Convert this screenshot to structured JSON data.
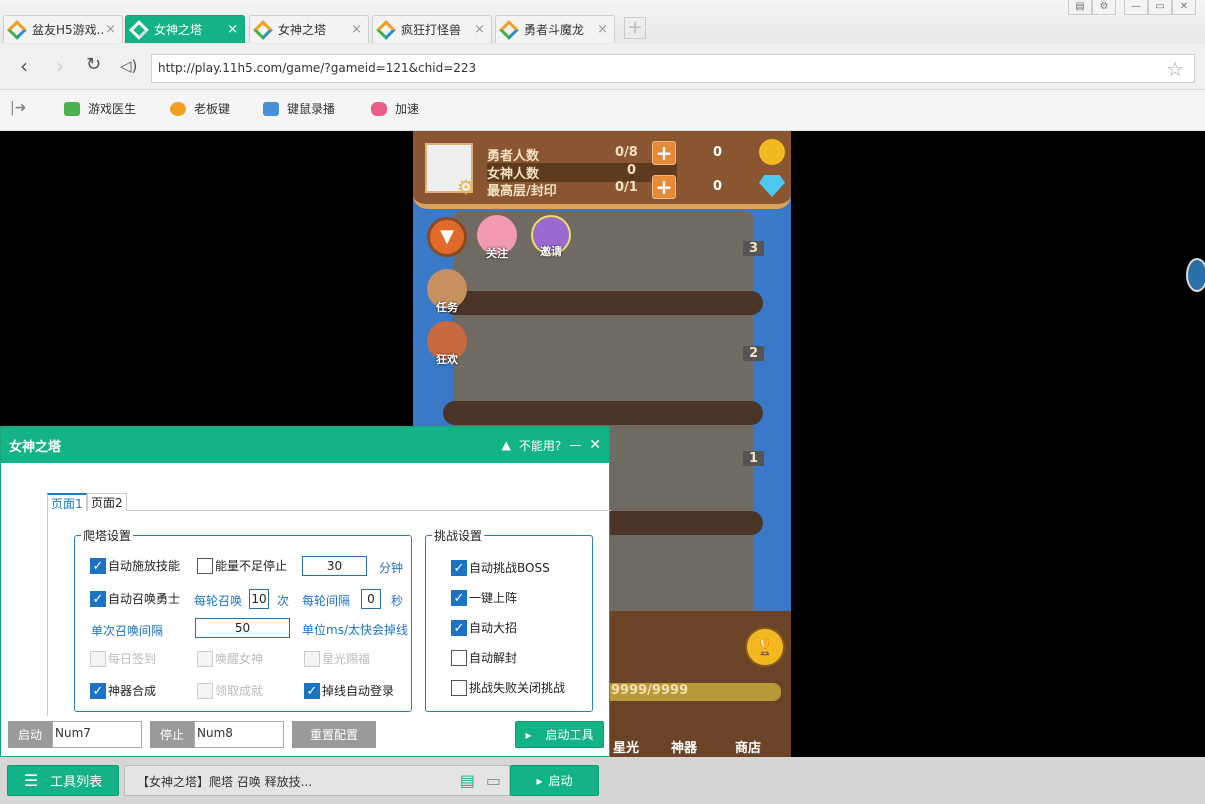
{
  "browser": {
    "tabs": [
      {
        "label": "盆友H5游戏...",
        "active": false
      },
      {
        "label": "女神之塔",
        "active": true
      },
      {
        "label": "女神之塔",
        "active": false
      },
      {
        "label": "疯狂打怪兽",
        "active": false
      },
      {
        "label": "勇者斗魔龙",
        "active": false
      }
    ],
    "new_tab": "+",
    "url": "http://play.11h5.com/game/?gameid=121&chid=223",
    "bookmarks": [
      {
        "label": "游戏医生",
        "icon": "medkit-icon",
        "color": "#4caf50"
      },
      {
        "label": "老板键",
        "icon": "eye-icon",
        "color": "#f0a020"
      },
      {
        "label": "键鼠录播",
        "icon": "keyboard-icon",
        "color": "#4a90d9"
      },
      {
        "label": "加速",
        "icon": "gamepad-icon",
        "color": "#e8608a"
      }
    ]
  },
  "game": {
    "stats": [
      {
        "label": "勇者人数",
        "value": "0/8"
      },
      {
        "label": "女神人数",
        "value": "0"
      },
      {
        "label": "最高层/封印",
        "value": "0/1"
      }
    ],
    "gold": "0",
    "diamond": "0",
    "buttons": {
      "follow": "关注",
      "invite": "邀请",
      "task": "任务",
      "carnival": "狂欢"
    },
    "floors": [
      "3",
      "2",
      "1"
    ],
    "hp": "9999/9999",
    "bottom_menu": [
      "星光",
      "神器",
      "商店"
    ]
  },
  "panel": {
    "title": "女神之塔",
    "help": "不能用?",
    "tabs": [
      "页面1",
      "页面2"
    ],
    "climb": {
      "legend": "爬塔设置",
      "auto_skill": {
        "label": "自动施放技能",
        "checked": true
      },
      "energy_stop": {
        "label": "能量不足停止",
        "checked": false
      },
      "minutes_value": "30",
      "minutes_unit": "分钟",
      "auto_summon": {
        "label": "自动召唤勇士",
        "checked": true
      },
      "per_round_label": "每轮召唤",
      "per_round_value": "10",
      "per_round_unit": "次",
      "interval_label": "每轮间隔",
      "interval_value": "0",
      "interval_unit": "秒",
      "single_label": "单次召唤间隔",
      "single_value": "50",
      "single_unit": "单位ms/太快会掉线",
      "daily_sign": {
        "label": "每日签到",
        "checked": false
      },
      "wake_goddess": {
        "label": "唤醒女神",
        "checked": false
      },
      "starlight": {
        "label": "星光赐福",
        "checked": false
      },
      "artifact": {
        "label": "神器合成",
        "checked": true
      },
      "achievement": {
        "label": "领取成就",
        "checked": false
      },
      "relogin": {
        "label": "掉线自动登录",
        "checked": true
      }
    },
    "challenge": {
      "legend": "挑战设置",
      "items": [
        {
          "label": "自动挑战BOSS",
          "checked": true
        },
        {
          "label": "一键上阵",
          "checked": true
        },
        {
          "label": "自动大招",
          "checked": true
        },
        {
          "label": "自动解封",
          "checked": false
        },
        {
          "label": "挑战失败关闭挑战",
          "checked": false
        }
      ]
    },
    "start_key_label": "启动",
    "start_key": "Num7",
    "stop_key_label": "停止",
    "stop_key": "Num8",
    "reset": "重置配置",
    "start_tool": "启动工具"
  },
  "bottom": {
    "tool_list": "工具列表",
    "status": "【女神之塔】爬塔 召唤 释放技...",
    "start": "启动"
  },
  "colors": {
    "accent": "#14b386",
    "checkbox": "#1c73c2"
  }
}
